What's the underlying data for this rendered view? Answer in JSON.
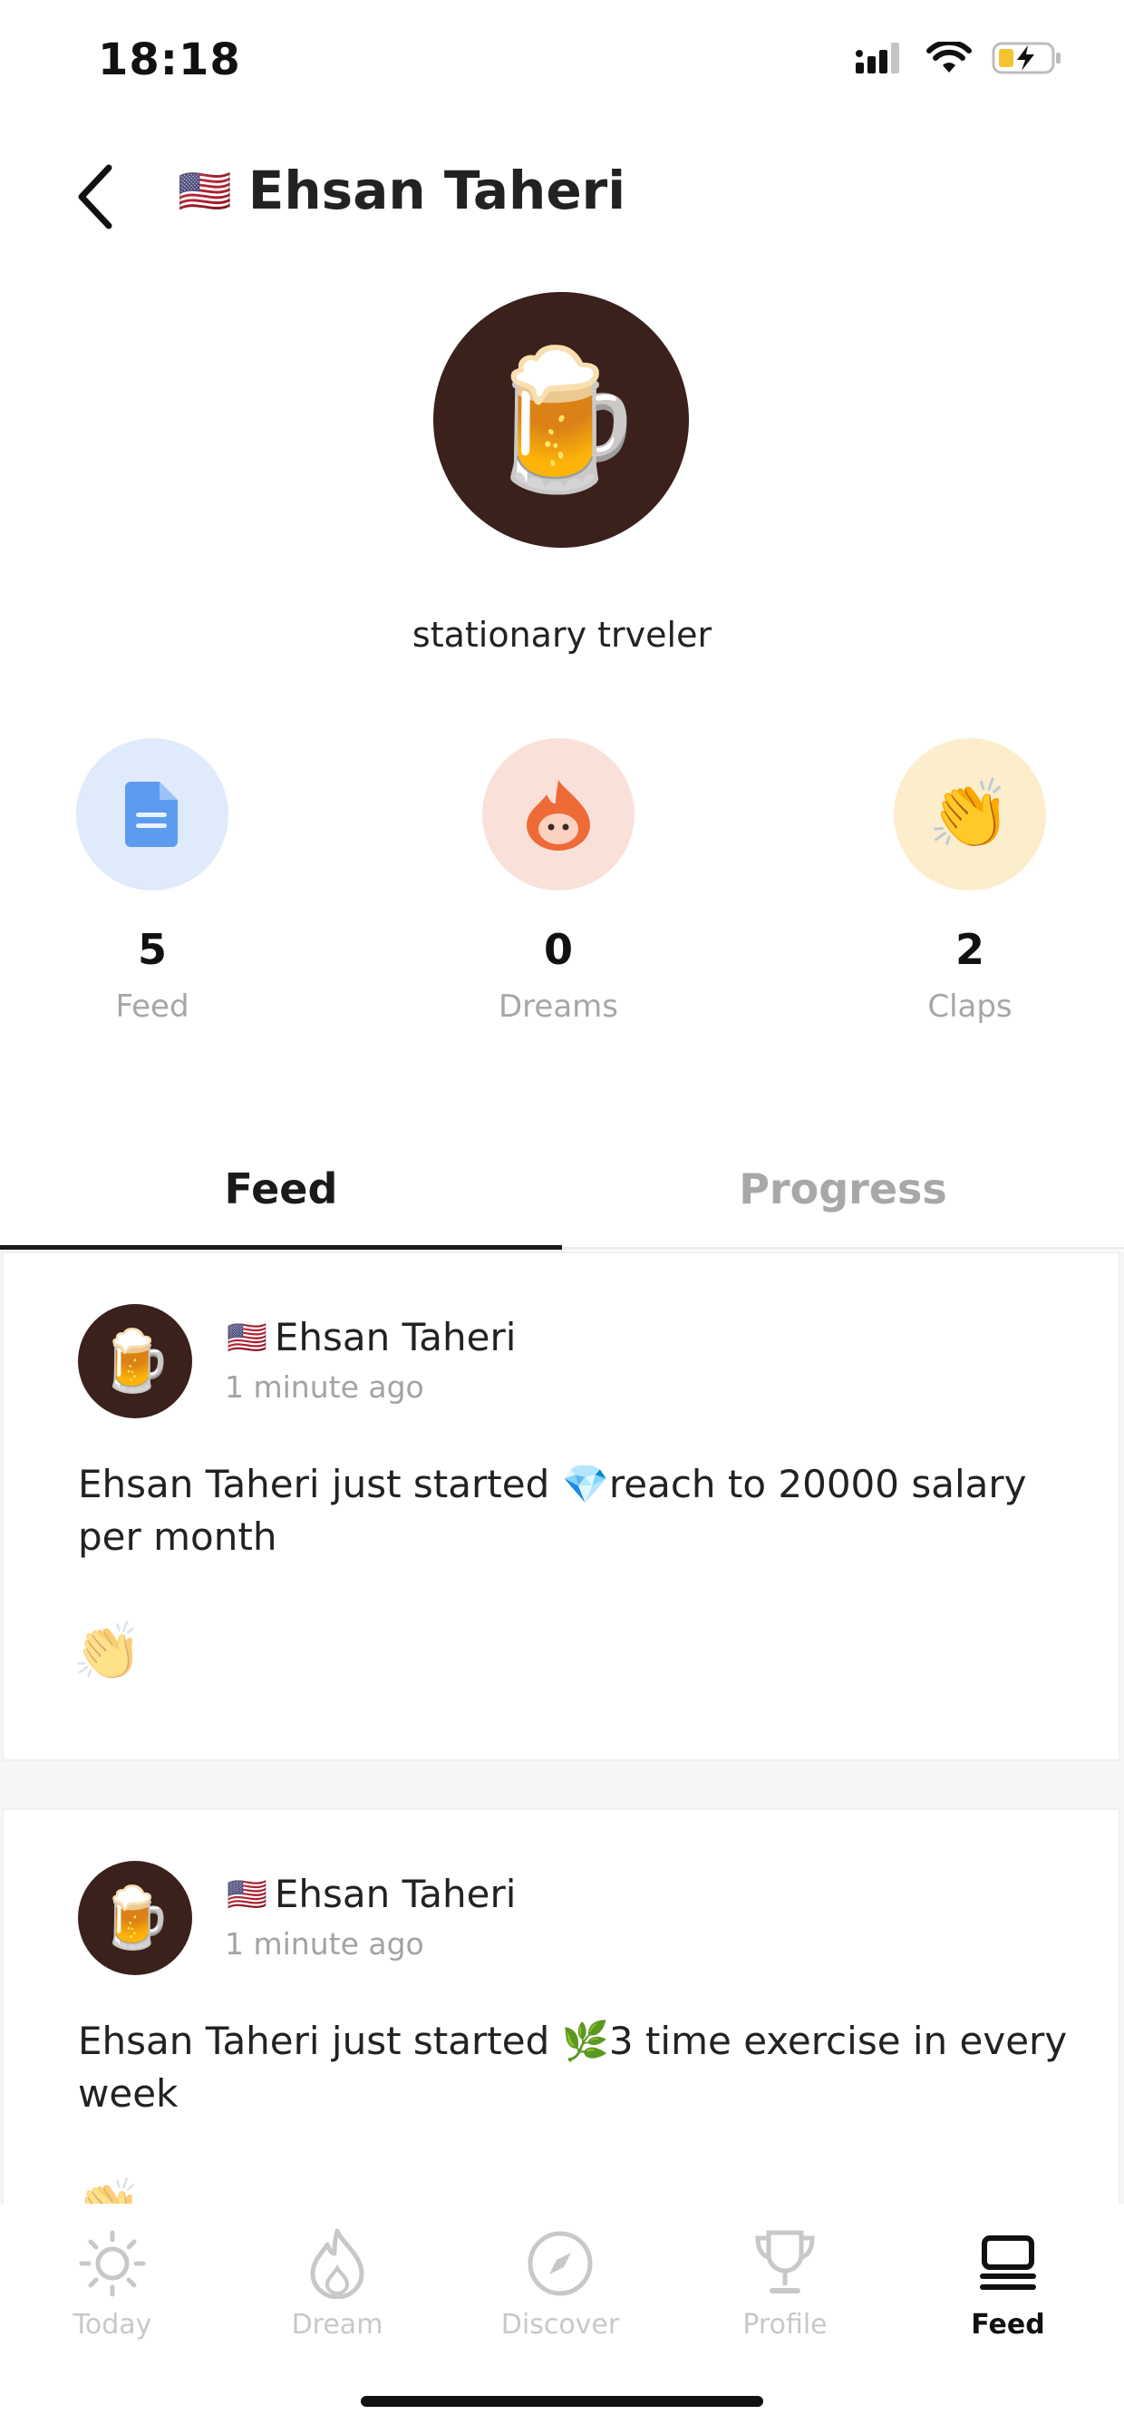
{
  "status_bar": {
    "time": "18:18"
  },
  "header": {
    "flag": "🇺🇸",
    "title": "Ehsan Taheri"
  },
  "profile": {
    "avatar": "🍺",
    "bio": "stationary trveler"
  },
  "stats": [
    {
      "icon": "document-icon",
      "value": "5",
      "label": "Feed",
      "color": "#dfeafa"
    },
    {
      "icon": "flame-drop-icon",
      "value": "0",
      "label": "Dreams",
      "color": "#f9e1d9"
    },
    {
      "icon": "clapping-hands-icon",
      "value": "2",
      "label": "Claps",
      "color": "#fcedcd"
    }
  ],
  "tabs": [
    {
      "label": "Feed",
      "active": true
    },
    {
      "label": "Progress",
      "active": false
    }
  ],
  "feed": [
    {
      "flag": "🇺🇸",
      "name": "Ehsan Taheri",
      "time": "1 minute ago",
      "text_prefix": "Ehsan Taheri just started ",
      "goal_icon": "💎",
      "goal": "reach to 20000 salary per month",
      "clap": "👏"
    },
    {
      "flag": "🇺🇸",
      "name": "Ehsan Taheri",
      "time": "1 minute ago",
      "text_prefix": "Ehsan Taheri just started ",
      "goal_icon": "🌿",
      "goal": "3 time exercise in every week",
      "clap": "👏"
    }
  ],
  "tabbar": [
    {
      "label": "Today",
      "icon": "sun-icon"
    },
    {
      "label": "Dream",
      "icon": "flame-icon"
    },
    {
      "label": "Discover",
      "icon": "compass-icon"
    },
    {
      "label": "Profile",
      "icon": "trophy-icon"
    },
    {
      "label": "Feed",
      "icon": "feed-stack-icon",
      "active": true
    }
  ]
}
